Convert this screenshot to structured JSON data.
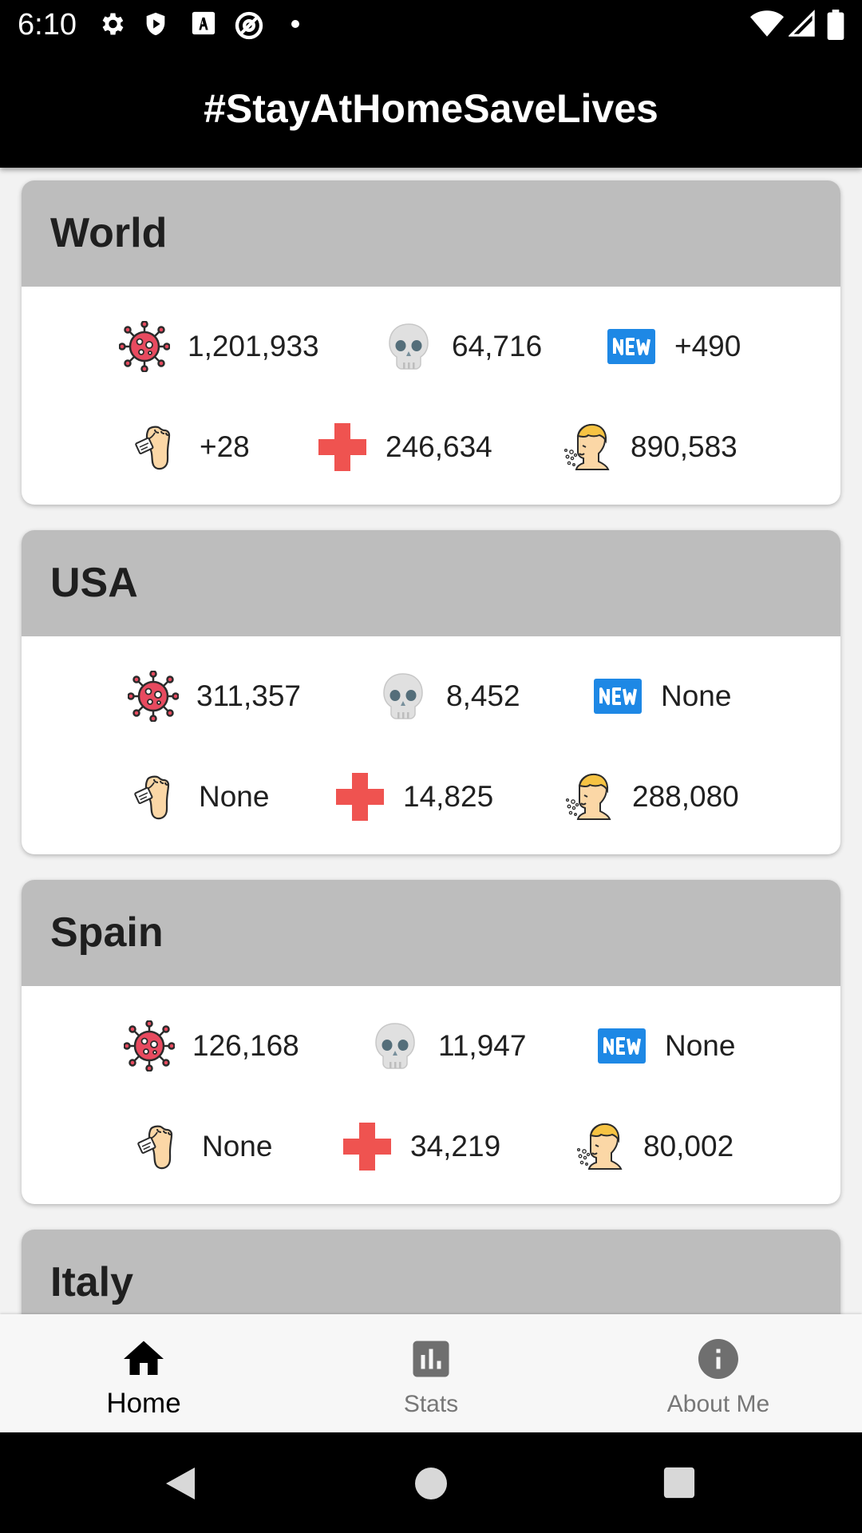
{
  "status_bar": {
    "time": "6:10"
  },
  "app_bar": {
    "title": "#StayAtHomeSaveLives"
  },
  "icons": {
    "cases": "virus-icon",
    "deaths": "skull-icon",
    "new_cases": "new-badge-icon",
    "new_deaths": "toe-tag-icon",
    "recovered": "red-cross-icon",
    "active": "sick-person-icon"
  },
  "colors": {
    "card_header": "#bdbdbd",
    "virus": "#e84a5f",
    "cross": "#ef5350",
    "new_badge": "#1e88e5"
  },
  "countries": [
    {
      "name": "World",
      "cases": "1,201,933",
      "deaths": "64,716",
      "new_cases": "+490",
      "new_deaths": "+28",
      "recovered": "246,634",
      "active": "890,583"
    },
    {
      "name": "USA",
      "cases": "311,357",
      "deaths": "8,452",
      "new_cases": "None",
      "new_deaths": "None",
      "recovered": "14,825",
      "active": "288,080"
    },
    {
      "name": "Spain",
      "cases": "126,168",
      "deaths": "11,947",
      "new_cases": "None",
      "new_deaths": "None",
      "recovered": "34,219",
      "active": "80,002"
    },
    {
      "name": "Italy"
    }
  ],
  "bottom_nav": {
    "items": [
      {
        "label": "Home",
        "active": true
      },
      {
        "label": "Stats",
        "active": false
      },
      {
        "label": "About Me",
        "active": false
      }
    ]
  }
}
